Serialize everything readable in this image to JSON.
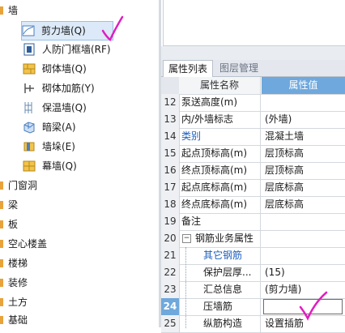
{
  "tree": {
    "root_label": "墙",
    "wall_items": [
      {
        "label": "剪力墙(Q)",
        "icon": "shear-wall-icon",
        "selected": true
      },
      {
        "label": "人防门框墙(RF)",
        "icon": "civil-defense-door-frame-wall-icon"
      },
      {
        "label": "砌体墙(Q)",
        "icon": "masonry-wall-icon"
      },
      {
        "label": "砌体加筋(Y)",
        "icon": "masonry-reinforcement-icon"
      },
      {
        "label": "保温墙(Q)",
        "icon": "insulation-wall-icon"
      },
      {
        "label": "暗梁(A)",
        "icon": "concealed-beam-icon"
      },
      {
        "label": "墙垛(E)",
        "icon": "wall-pier-icon"
      },
      {
        "label": "幕墙(Q)",
        "icon": "curtain-wall-icon"
      }
    ],
    "categories": [
      "门窗洞",
      "梁",
      "板",
      "空心楼盖",
      "楼梯",
      "装修",
      "土方",
      "基础"
    ]
  },
  "tabs": [
    {
      "label": "属性列表",
      "active": true
    },
    {
      "label": "图层管理",
      "active": false
    }
  ],
  "grid": {
    "header": {
      "name": "属性名称",
      "value": "属性值"
    },
    "rows": [
      {
        "n": "12",
        "k": "泵送高度(m)",
        "v": ""
      },
      {
        "n": "13",
        "k": "内/外墙标志",
        "v": "(外墙)"
      },
      {
        "n": "14",
        "k": "类别",
        "v": "混凝土墙",
        "blue": true
      },
      {
        "n": "15",
        "k": "起点顶标高(m)",
        "v": "层顶标高"
      },
      {
        "n": "16",
        "k": "终点顶标高(m)",
        "v": "层顶标高"
      },
      {
        "n": "17",
        "k": "起点底标高(m)",
        "v": "层底标高"
      },
      {
        "n": "18",
        "k": "终点底标高(m)",
        "v": "层底标高"
      },
      {
        "n": "19",
        "k": "备注",
        "v": ""
      },
      {
        "n": "20",
        "k": "钢筋业务属性",
        "v": "",
        "group": true
      },
      {
        "n": "21",
        "k": "其它钢筋",
        "v": "",
        "blue": true
      },
      {
        "n": "22",
        "k": "保护层厚...",
        "v": "(15)"
      },
      {
        "n": "23",
        "k": "汇总信息",
        "v": "(剪力墙)"
      },
      {
        "n": "24",
        "k": "压墙筋",
        "v": "",
        "selected": true
      },
      {
        "n": "25",
        "k": "纵筋构造",
        "v": "设置插筋"
      }
    ]
  },
  "colors": {
    "accent": "#6fa8dc",
    "link": "#1d5fbf",
    "annotation": "#e01ec0"
  }
}
